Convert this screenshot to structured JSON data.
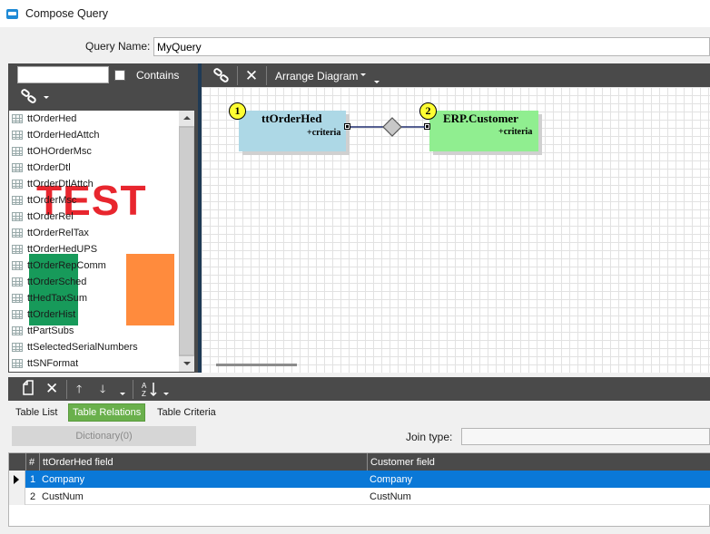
{
  "window": {
    "title": "Compose Query"
  },
  "query": {
    "name_label": "Query Name:",
    "name_value": "MyQuery"
  },
  "left_panel": {
    "search_value": "",
    "contains_label": "Contains",
    "tables": [
      "ttOrderHed",
      "ttOrderHedAttch",
      "ttOHOrderMsc",
      "ttOrderDtl",
      "ttOrderDtlAttch",
      "ttOrderMsc",
      "ttOrderRel",
      "ttOrderRelTax",
      "ttOrderHedUPS",
      "ttOrderRepComm",
      "ttOrderSched",
      "ttHedTaxSum",
      "ttOrderHist",
      "ttPartSubs",
      "ttSelectedSerialNumbers",
      "ttSNFormat"
    ]
  },
  "overlays": {
    "watermark_text": "TEST"
  },
  "diagram_toolbar": {
    "arrange_label": "Arrange Diagram"
  },
  "diagram": {
    "nodes": [
      {
        "badge": "1",
        "title": "ttOrderHed",
        "criteria": "+criteria"
      },
      {
        "badge": "2",
        "title": "ERP.Customer",
        "criteria": "+criteria"
      }
    ]
  },
  "tabs": [
    {
      "label": "Table List",
      "active": false
    },
    {
      "label": "Table Relations",
      "active": true
    },
    {
      "label": "Table Criteria",
      "active": false
    }
  ],
  "relations": {
    "dictionary_label": "Dictionary(0)",
    "join_label": "Join type:",
    "join_value": "",
    "columns": {
      "num": "#",
      "left": "ttOrderHed field",
      "right": "Customer field"
    },
    "rows": [
      {
        "num": "1",
        "left": "Company",
        "right": "Company",
        "selected": true
      },
      {
        "num": "2",
        "left": "CustNum",
        "right": "CustNum",
        "selected": false
      }
    ]
  },
  "colors": {
    "toolbar_bg": "#4a4a4a",
    "selected_row": "#0a78d7",
    "active_tab": "#6ab04c",
    "node1_fill": "#add8e6",
    "node2_fill": "#90ee90",
    "badge_fill": "#ffff33"
  }
}
